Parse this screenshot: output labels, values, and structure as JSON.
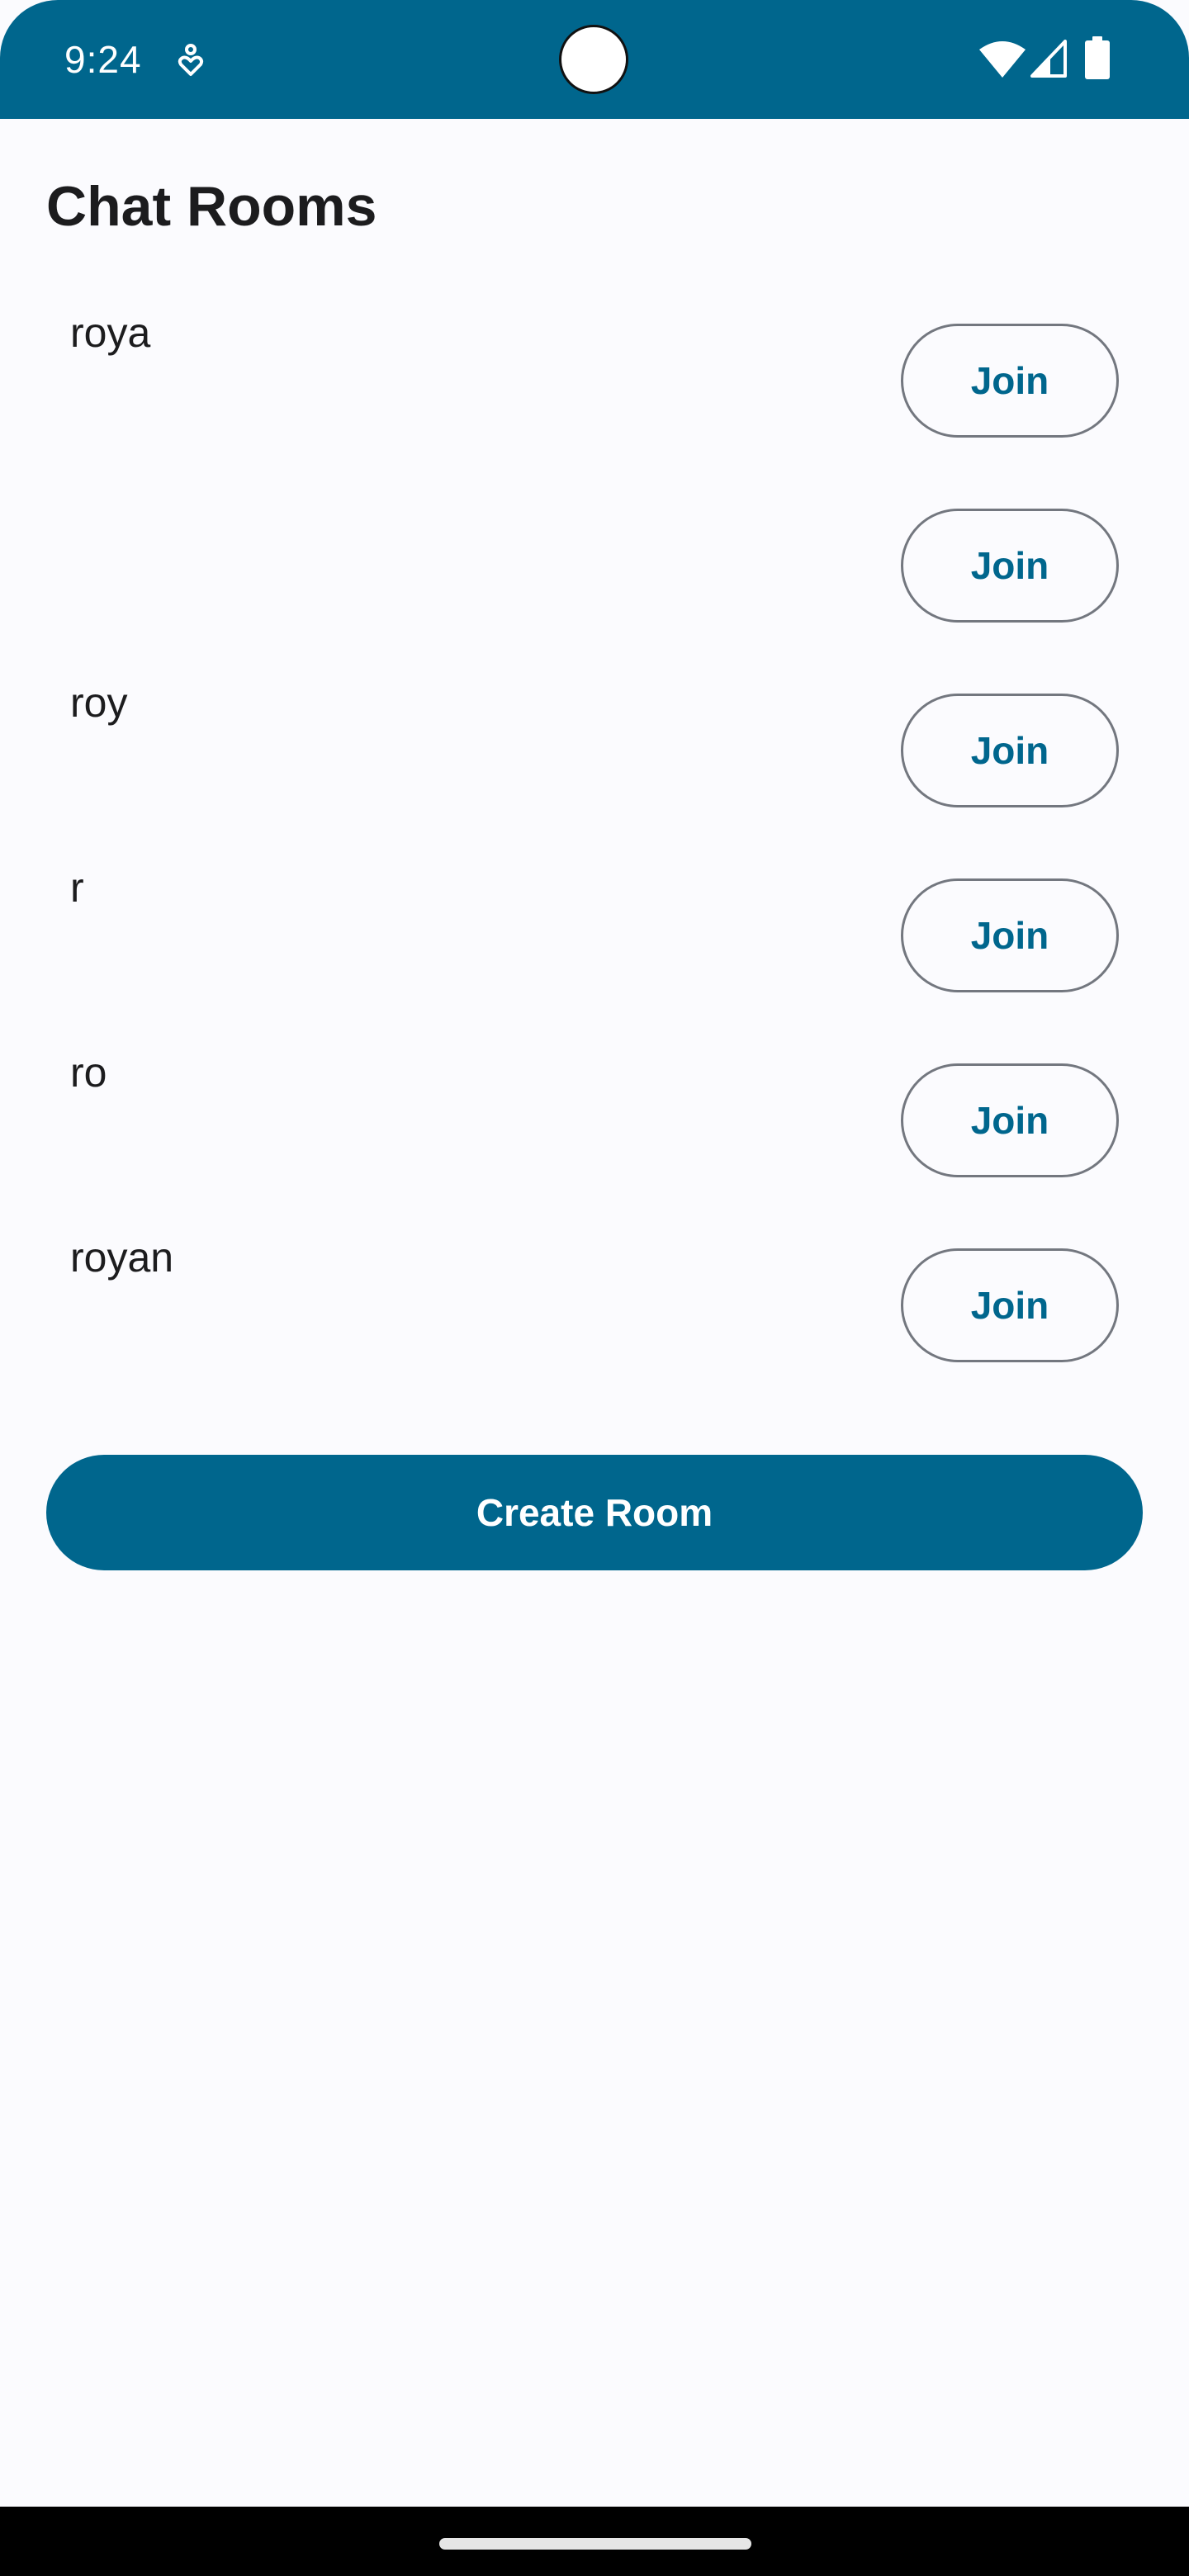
{
  "status_bar": {
    "time": "9:24",
    "icons": [
      "app-notification-icon",
      "wifi-icon",
      "cellular-signal-icon",
      "battery-icon"
    ],
    "background_color": "#00668d"
  },
  "page": {
    "title": "Chat Rooms"
  },
  "rooms": [
    {
      "name": "roya",
      "join_label": "Join"
    },
    {
      "name": "",
      "join_label": "Join"
    },
    {
      "name": "roy",
      "join_label": "Join"
    },
    {
      "name": "r",
      "join_label": "Join"
    },
    {
      "name": "ro",
      "join_label": "Join"
    },
    {
      "name": "royan",
      "join_label": "Join"
    }
  ],
  "actions": {
    "create_room_label": "Create Room"
  },
  "colors": {
    "accent": "#00668d",
    "background": "#fbfbfe",
    "outline": "#73777f",
    "text": "#1c1c1e"
  }
}
